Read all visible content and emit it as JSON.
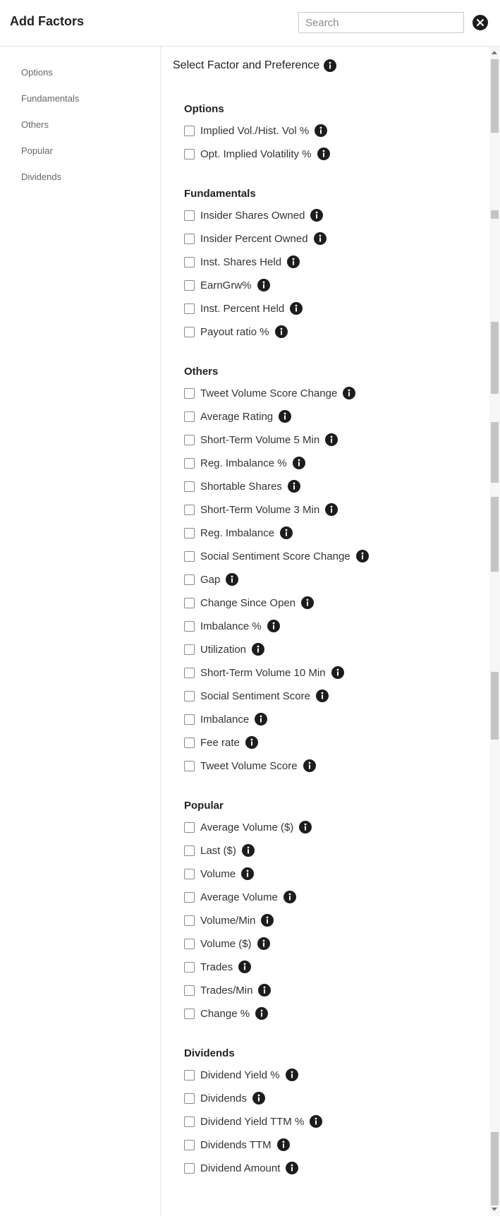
{
  "header": {
    "title": "Add Factors",
    "search_placeholder": "Search",
    "search_value": "",
    "close_icon": "close-icon"
  },
  "sidebar": {
    "items": [
      {
        "label": "Options"
      },
      {
        "label": "Fundamentals"
      },
      {
        "label": "Others"
      },
      {
        "label": "Popular"
      },
      {
        "label": "Dividends"
      }
    ]
  },
  "main": {
    "heading": "Select Factor and Preference",
    "sections": [
      {
        "title": "Options",
        "items": [
          {
            "label": "Implied Vol./Hist. Vol %",
            "checked": false
          },
          {
            "label": "Opt. Implied Volatility %",
            "checked": false
          }
        ]
      },
      {
        "title": "Fundamentals",
        "items": [
          {
            "label": "Insider Shares Owned",
            "checked": false
          },
          {
            "label": "Insider Percent Owned",
            "checked": false
          },
          {
            "label": "Inst. Shares Held",
            "checked": false
          },
          {
            "label": "EarnGrw%",
            "checked": false
          },
          {
            "label": "Inst. Percent Held",
            "checked": false
          },
          {
            "label": "Payout ratio %",
            "checked": false
          }
        ]
      },
      {
        "title": "Others",
        "items": [
          {
            "label": "Tweet Volume Score Change",
            "checked": false
          },
          {
            "label": "Average Rating",
            "checked": false
          },
          {
            "label": "Short-Term Volume 5 Min",
            "checked": false
          },
          {
            "label": "Reg. Imbalance %",
            "checked": false
          },
          {
            "label": "Shortable Shares",
            "checked": false
          },
          {
            "label": "Short-Term Volume 3 Min",
            "checked": false
          },
          {
            "label": "Reg. Imbalance",
            "checked": false
          },
          {
            "label": "Social Sentiment Score Change",
            "checked": false
          },
          {
            "label": "Gap",
            "checked": false
          },
          {
            "label": "Change Since Open",
            "checked": false
          },
          {
            "label": "Imbalance %",
            "checked": false
          },
          {
            "label": "Utilization",
            "checked": false
          },
          {
            "label": "Short-Term Volume 10 Min",
            "checked": false
          },
          {
            "label": "Social Sentiment Score",
            "checked": false
          },
          {
            "label": "Imbalance",
            "checked": false
          },
          {
            "label": "Fee rate",
            "checked": false
          },
          {
            "label": "Tweet Volume Score",
            "checked": false
          }
        ]
      },
      {
        "title": "Popular",
        "items": [
          {
            "label": "Average Volume ($)",
            "checked": false
          },
          {
            "label": "Last ($)",
            "checked": false
          },
          {
            "label": "Volume",
            "checked": false
          },
          {
            "label": "Average Volume",
            "checked": false
          },
          {
            "label": "Volume/Min",
            "checked": false
          },
          {
            "label": "Volume ($)",
            "checked": false
          },
          {
            "label": "Trades",
            "checked": false
          },
          {
            "label": "Trades/Min",
            "checked": false
          },
          {
            "label": "Change %",
            "checked": false
          }
        ]
      },
      {
        "title": "Dividends",
        "items": [
          {
            "label": "Dividend Yield %",
            "checked": false
          },
          {
            "label": "Dividends",
            "checked": false
          },
          {
            "label": "Dividend Yield TTM %",
            "checked": false
          },
          {
            "label": "Dividends TTM",
            "checked": false
          },
          {
            "label": "Dividend Amount",
            "checked": false
          }
        ]
      }
    ]
  }
}
